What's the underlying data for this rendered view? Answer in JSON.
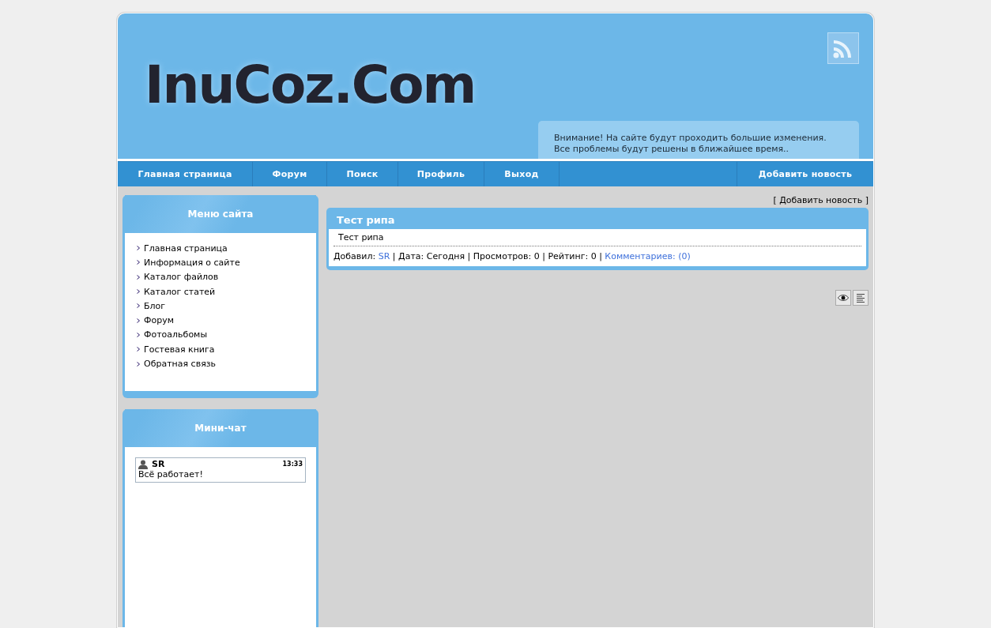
{
  "header": {
    "logo": "InuCoz.Com",
    "notice": [
      "Внимание! На сайте будут проходить большие изменения.",
      "Все проблемы будут решены в ближайшее время.."
    ]
  },
  "nav": {
    "items": [
      {
        "label": "Главная страница"
      },
      {
        "label": "Форум"
      },
      {
        "label": "Поиск"
      },
      {
        "label": "Профиль"
      },
      {
        "label": "Выход"
      }
    ],
    "right": "Добавить новость"
  },
  "sidebar": {
    "blocks": [
      {
        "kind": "menu",
        "title": "Меню сайта",
        "items": [
          "Главная страница",
          "Информация о сайте",
          "Каталог файлов",
          "Каталог статей",
          "Блог",
          "Форум",
          "Фотоальбомы",
          "Гостевая книга",
          "Обратная связь"
        ]
      },
      {
        "kind": "chat",
        "title": "Мини-чат",
        "messages": [
          {
            "user": "SR",
            "time": "13:33",
            "text": "Всё работает!"
          }
        ]
      }
    ]
  },
  "content": {
    "add_link": "[ Добавить новость ]",
    "entries": [
      {
        "title": "Тест рипа",
        "body": "Тест рипа",
        "meta": [
          {
            "kind": "text",
            "text": "Добавил: "
          },
          {
            "kind": "link",
            "text": "SR"
          },
          {
            "kind": "text",
            "text": " | Дата: Сегодня | Просмотров: 0 | Рейтинг: 0 | "
          },
          {
            "kind": "link",
            "text": "Комментариев: (0)"
          }
        ]
      }
    ]
  }
}
